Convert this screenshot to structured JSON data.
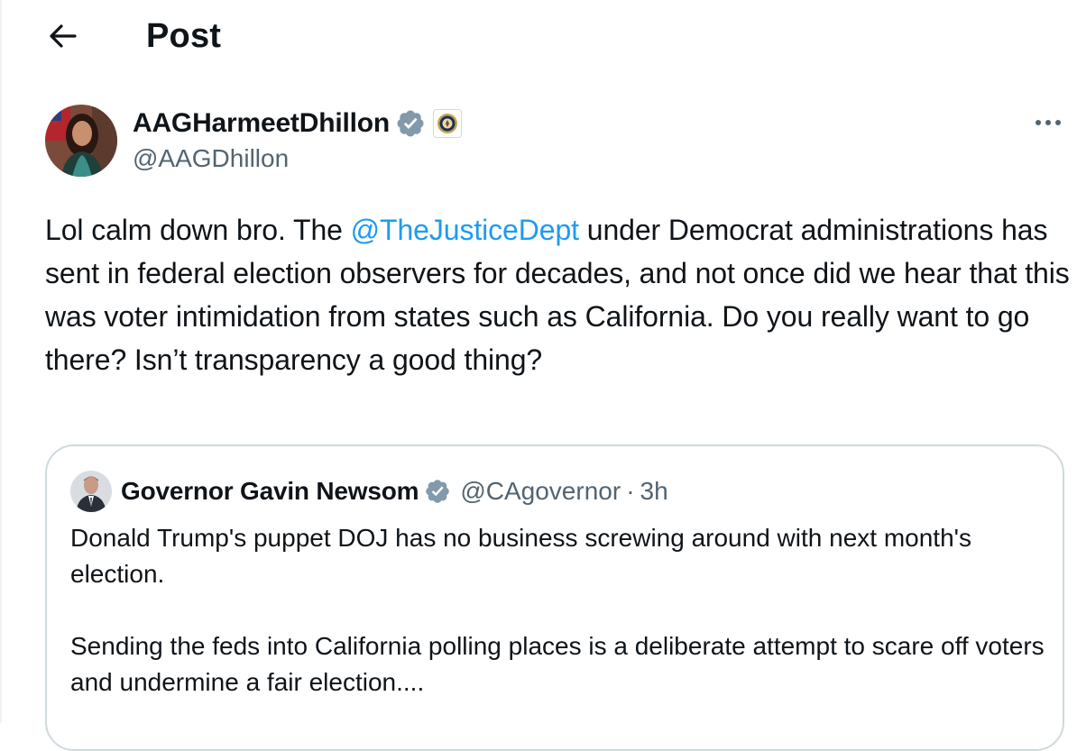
{
  "header": {
    "title": "Post",
    "back_icon": "arrow-left-icon"
  },
  "post": {
    "author": {
      "display_name": "AAGHarmeetDhillon",
      "handle": "@AAGDhillon",
      "verified_icon": "verified-badge-icon",
      "affiliation_icon": "doj-seal-icon"
    },
    "more_icon": "more-horizontal-icon",
    "text": {
      "part1": "Lol calm down bro. The ",
      "mention": "@TheJusticeDept",
      "part2": " under Democrat administrations has sent in federal election observers for decades, and not once did we hear that this was voter intimidation from states such as California. Do you really want to go there? Isn’t transparency a good thing?"
    }
  },
  "quote": {
    "author": {
      "display_name": "Governor Gavin Newsom",
      "handle": "@CAgovernor",
      "verified_icon": "verified-badge-icon"
    },
    "separator": "·",
    "time": "3h",
    "text": "Donald Trump's puppet DOJ has no business screwing around with next month's election.\n\nSending the feds into California polling places is a deliberate attempt to scare off voters and undermine a fair election...."
  },
  "colors": {
    "link": "#1d9bf0",
    "secondary_text": "#536471",
    "verified_gray": "#829aab",
    "border": "#cfd9de"
  }
}
